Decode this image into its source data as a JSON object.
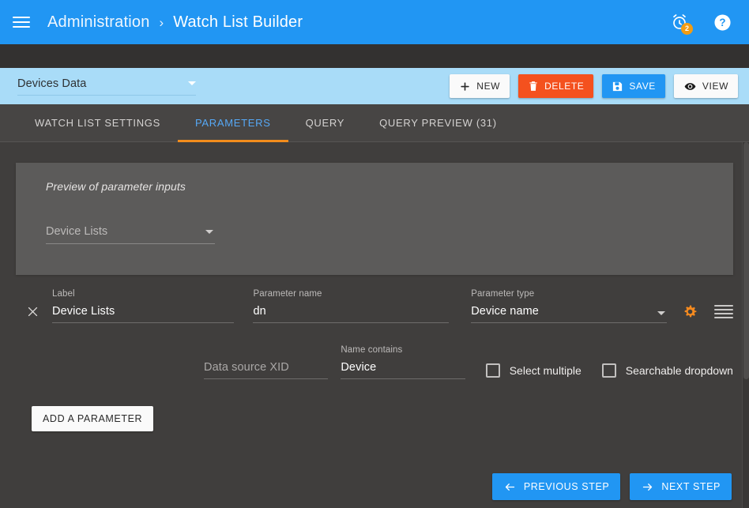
{
  "header": {
    "menu_icon": "hamburger-menu-icon",
    "breadcrumb": {
      "parent": "Administration",
      "separator": "›",
      "current": "Watch List Builder"
    },
    "alarms": {
      "icon": "alarm-clock-icon",
      "badge_count": "2",
      "badge_color": "#f39c12"
    },
    "help": {
      "icon": "help-circle-icon"
    },
    "background_color": "#2196f3"
  },
  "toolbar": {
    "watchlist_select": {
      "value": "Devices Data",
      "caret_icon": "chevron-down-icon"
    },
    "buttons": [
      {
        "label": "NEW",
        "icon": "plus-icon",
        "style": "light"
      },
      {
        "label": "DELETE",
        "icon": "trash-icon",
        "style": "danger"
      },
      {
        "label": "SAVE",
        "icon": "floppy-disk-icon",
        "style": "primary"
      },
      {
        "label": "VIEW",
        "icon": "eye-icon",
        "style": "light"
      }
    ],
    "background_color": "#a9dcf8"
  },
  "tabs": {
    "items": [
      {
        "label": "WATCH LIST SETTINGS",
        "active": false
      },
      {
        "label": "PARAMETERS",
        "active": true
      },
      {
        "label": "QUERY",
        "active": false
      },
      {
        "label": "QUERY PREVIEW (31)",
        "active": false
      }
    ],
    "active_color": "#56a8f5",
    "indicator_color": "#f28c1c"
  },
  "preview": {
    "title": "Preview of parameter inputs",
    "input": {
      "placeholder": "Device Lists",
      "caret_icon": "chevron-down-icon"
    }
  },
  "parameter": {
    "remove_icon": "close-x-icon",
    "label_field": {
      "label": "Label",
      "value": "Device Lists"
    },
    "name_field": {
      "label": "Parameter name",
      "value": "dn"
    },
    "type_field": {
      "label": "Parameter type",
      "value": "Device name",
      "caret_icon": "chevron-down-icon"
    },
    "settings_icon": "gear-icon",
    "settings_icon_color": "#f58a1f",
    "drag_icon": "drag-handle-icon",
    "xid_field": {
      "label": "",
      "placeholder": "Data source XID",
      "value": ""
    },
    "contains_field": {
      "label": "Name contains",
      "value": "Device"
    },
    "checkboxes": [
      {
        "label": "Select multiple",
        "checked": false
      },
      {
        "label": "Searchable dropdown",
        "checked": false
      }
    ]
  },
  "actions": {
    "add_parameter": "ADD A PARAMETER",
    "previous_step": "PREVIOUS STEP",
    "next_step": "NEXT STEP",
    "prev_icon": "arrow-left-icon",
    "next_icon": "arrow-right-icon"
  }
}
